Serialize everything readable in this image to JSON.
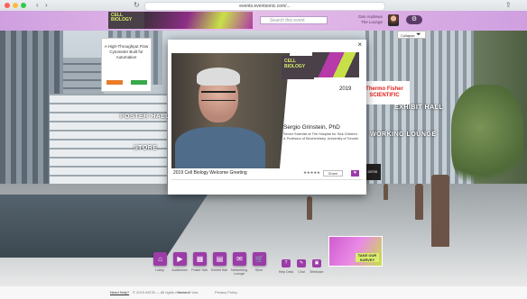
{
  "browser": {
    "url": "events.eventsonic.com/...",
    "colors": {
      "chrome": "#dfe2e6",
      "close": "#fc605c",
      "min": "#fdbc40",
      "max": "#34c84a"
    }
  },
  "header": {
    "logo_text": "CELL BIOLOGY",
    "search_placeholder": "Search this event",
    "user_line1": "Dan Andrews",
    "user_line2": "The Lounge",
    "settings_icon": "gear-icon",
    "collapse_label": "Collapse",
    "accent": "#9b3ca8"
  },
  "scene": {
    "promo": {
      "title": "A High-Throughput Flow Cytometer Built for Automation"
    },
    "labels": {
      "poster_hall": "POSTER HALL",
      "store": "STORE",
      "exhibit_hall": "EXHIBIT HALL",
      "working_lounge": "WORKING LOUNGE",
      "lounge_desk": "DESK"
    },
    "sponsor_sign": "Thermo Fisher SCIENTIFIC",
    "survey": "TAKE OUR SURVEY"
  },
  "modal": {
    "close": "×",
    "video": {
      "logo": "CELL BIOLOGY",
      "year": "2019",
      "speaker_name": "Sergio Grinstein, PhD",
      "speaker_title": "Senior Scientist at The Hospital for Sick Children & Professor of Biochemistry, University of Toronto"
    },
    "caption": "2019 Cell Biology Welcome Greeting",
    "rating": "★★★★★",
    "share_label": "Share"
  },
  "bottom_nav": {
    "items": [
      {
        "label": "Lobby",
        "icon": "home-icon",
        "glyph": "⌂"
      },
      {
        "label": "Auditorium",
        "icon": "presentation-icon",
        "glyph": "▶"
      },
      {
        "label": "Poster Hall",
        "icon": "poster-icon",
        "glyph": "▦"
      },
      {
        "label": "Exhibit Hall",
        "icon": "booth-icon",
        "glyph": "▤"
      },
      {
        "label": "Networking Lounge",
        "icon": "chat-icon",
        "glyph": "✉"
      },
      {
        "label": "Store",
        "icon": "cart-icon",
        "glyph": "🛒"
      }
    ],
    "small_items": [
      {
        "label": "Help Desk",
        "glyph": "?"
      },
      {
        "label": "Chat",
        "glyph": "✎"
      },
      {
        "label": "Briefcase",
        "glyph": "▣"
      }
    ]
  },
  "footer": {
    "support": "Need Help?",
    "copyright": "© 2019 ASCB — All rights reserved",
    "terms": "Terms of Use",
    "privacy": "Privacy Policy"
  }
}
